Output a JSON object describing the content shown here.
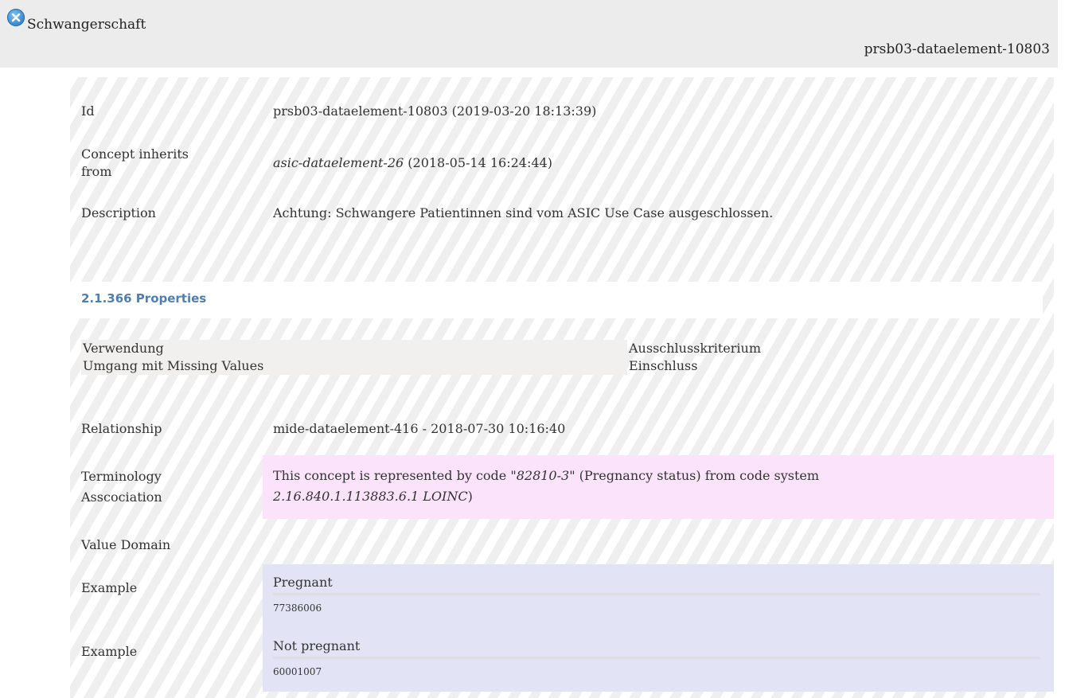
{
  "header": {
    "title": "Schwangerschaft",
    "element_id": "prsb03-dataelement-10803"
  },
  "concept": {
    "id_label": "Id",
    "id_value": "prsb03-dataelement-10803 (2019-03-20 18:13:39)",
    "inherits_label_line1": "Concept inherits",
    "inherits_label_line2": "from",
    "inherits_ref": "asic-dataelement-26",
    "inherits_date": " (2018-05-14 16:24:44)",
    "description_label": "Description",
    "description_value": "Achtung: Schwangere Patientinnen sind vom ASIC Use Case ausgeschlossen."
  },
  "properties": {
    "heading": "2.1.366 Properties",
    "rows": [
      {
        "key": "Verwendung",
        "value": "Ausschlusskriterium"
      },
      {
        "key": "Umgang mit Missing Values",
        "value": "Einschluss"
      }
    ]
  },
  "relationship": {
    "label": "Relationship",
    "value": "mide-dataelement-416 - 2018-07-30 10:16:40"
  },
  "terminology": {
    "label_line1": "Terminology",
    "label_line2": "Asscociation",
    "prefix": "This concept is represented by code \"",
    "code": "82810-3",
    "middle": "\" (Pregnancy status) from code system",
    "system": "2.16.840.1.113883.6.1 LOINC",
    "suffix": ")"
  },
  "value_domain": {
    "label": "Value Domain"
  },
  "examples": [
    {
      "label": "Example",
      "name": "Pregnant",
      "code": "77386006"
    },
    {
      "label": "Example",
      "name": "Not pregnant",
      "code": "60001007"
    }
  ]
}
